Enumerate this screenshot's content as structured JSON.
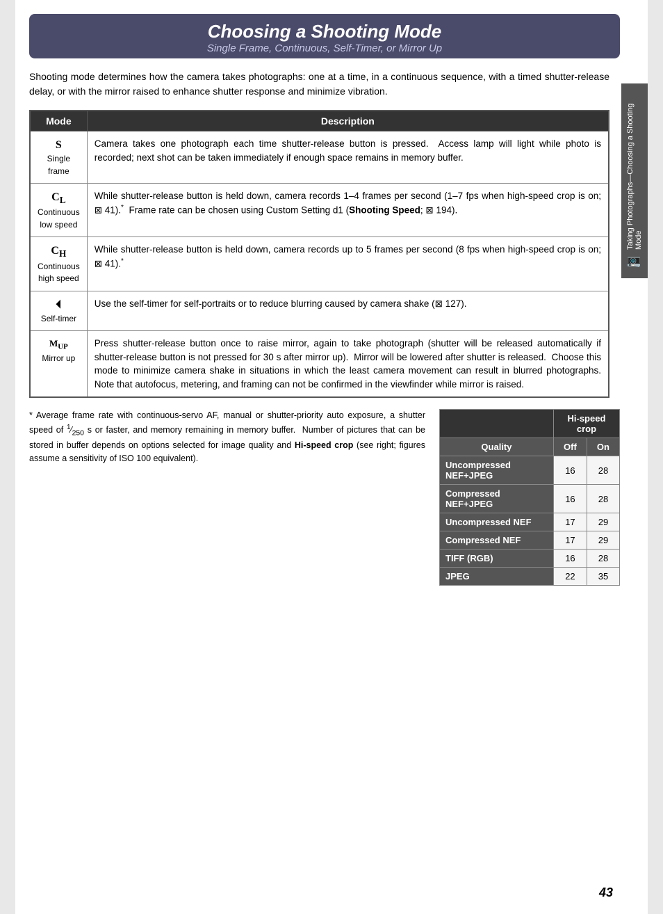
{
  "title": {
    "main": "Choosing a Shooting Mode",
    "sub": "Single Frame, Continuous, Self-Timer, or Mirror Up"
  },
  "intro": "Shooting mode determines how the camera takes photographs: one at a time, in a continuous sequence, with a timed shutter-release delay, or with the mirror raised to enhance shutter response and minimize vibration.",
  "table": {
    "col_mode": "Mode",
    "col_desc": "Description",
    "rows": [
      {
        "mode_letter": "S",
        "mode_name": "Single\nframe",
        "description": "Camera takes one photograph each time shutter-release button is pressed.  Access lamp will light while photo is recorded; next shot can be taken immediately if enough space remains in memory buffer."
      },
      {
        "mode_letter": "CL",
        "mode_name": "Continuous\nlow speed",
        "description": "While shutter-release button is held down, camera records 1–4 frames per second (1–7 fps when high-speed crop is on; ⊠ 41).*  Frame rate can be chosen using Custom Setting d1 (Shooting Speed; ⊠ 194)."
      },
      {
        "mode_letter": "CH",
        "mode_name": "Continuous\nhigh speed",
        "description": "While shutter-release button is held down, camera records up to 5 frames per second (8 fps when high-speed crop is on; ⊠ 41).*"
      },
      {
        "mode_letter": "⏱",
        "mode_name": "Self-timer",
        "description": "Use the self-timer for self-portraits or to reduce blurring caused by camera shake (⊠ 127)."
      },
      {
        "mode_letter": "M-UP",
        "mode_name": "Mirror up",
        "description": "Press shutter-release button once to raise mirror, again to take photograph (shutter will be released automatically if shutter-release button is not pressed for 30 s after mirror up).  Mirror will be lowered after shutter is released.  Choose this mode to minimize camera shake in situations in which the least camera movement can result in blurred photographs. Note that autofocus, metering, and framing can not be confirmed in the viewfinder while mirror is raised."
      }
    ]
  },
  "footnote": "* Average frame rate with continuous-servo AF, manual or shutter-priority auto exposure, a shutter speed of 1⁄250 s or faster, and memory remaining in memory buffer.  Number of pictures that can be stored in buffer depends on options selected for image quality and Hi-speed crop (see right; figures assume a sensitivity of ISO 100 equivalent).",
  "crop_table": {
    "header": "Hi-speed crop",
    "col_quality": "Quality",
    "col_off": "Off",
    "col_on": "On",
    "rows": [
      {
        "label": "Uncompressed NEF+JPEG",
        "off": "16",
        "on": "28"
      },
      {
        "label": "Compressed NEF+JPEG",
        "off": "16",
        "on": "28"
      },
      {
        "label": "Uncompressed NEF",
        "off": "17",
        "on": "29"
      },
      {
        "label": "Compressed NEF",
        "off": "17",
        "on": "29"
      },
      {
        "label": "TIFF (RGB)",
        "off": "16",
        "on": "28"
      },
      {
        "label": "JPEG",
        "off": "22",
        "on": "35"
      }
    ]
  },
  "side_tab": "Taking Photographs—Choosing a Shooting Mode",
  "page_number": "43"
}
